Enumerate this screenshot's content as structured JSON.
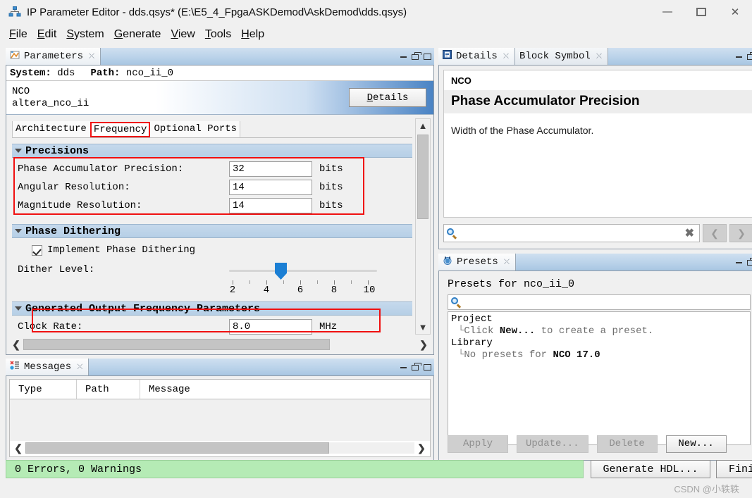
{
  "window": {
    "title": "IP Parameter Editor - dds.qsys* (E:\\E5_4_FpgaASKDemod\\AskDemod\\dds.qsys)",
    "icon": "ip-editor-icon",
    "controls": {
      "minimize": "—",
      "maximize": "□",
      "close": "✕"
    }
  },
  "menubar": {
    "items": [
      {
        "pre": "",
        "key": "F",
        "post": "ile"
      },
      {
        "pre": "",
        "key": "E",
        "post": "dit"
      },
      {
        "pre": "",
        "key": "S",
        "post": "ystem"
      },
      {
        "pre": "",
        "key": "G",
        "post": "enerate"
      },
      {
        "pre": "",
        "key": "V",
        "post": "iew"
      },
      {
        "pre": "",
        "key": "T",
        "post": "ools"
      },
      {
        "pre": "",
        "key": "H",
        "post": "elp"
      }
    ]
  },
  "parameters_panel": {
    "tab_label": "Parameters",
    "tab_icon": "parameters-icon",
    "system_label": "System:",
    "system_value": "dds",
    "path_label": "Path:",
    "path_value": "nco_ii_0",
    "component_name": "NCO",
    "component_id": "altera_nco_ii",
    "details_button": {
      "key": "D",
      "rest": "etails"
    },
    "tabs": [
      {
        "label": "Architecture",
        "selected": false
      },
      {
        "label": "Frequency",
        "selected": true
      },
      {
        "label": "Optional Ports",
        "selected": false
      }
    ],
    "groups": [
      {
        "title": "Precisions",
        "rows": [
          {
            "label": "Phase Accumulator Precision:",
            "value": "32",
            "unit": "bits"
          },
          {
            "label": "Angular Resolution:",
            "value": "14",
            "unit": "bits"
          },
          {
            "label": "Magnitude Resolution:",
            "value": "14",
            "unit": "bits"
          }
        ]
      },
      {
        "title": "Phase Dithering",
        "checkbox_label": "Implement Phase Dithering",
        "checkbox_checked": true,
        "slider_label": "Dither Level:",
        "slider_value": 4,
        "slider_ticks": [
          "2",
          "4",
          "6",
          "8",
          "10"
        ]
      },
      {
        "title": "Generated Output Frequency Parameters",
        "rows": [
          {
            "label": "Clock Rate:",
            "value": "8.0",
            "unit": "MHz"
          }
        ]
      }
    ]
  },
  "messages_panel": {
    "tab_label": "Messages",
    "tab_icon": "messages-icon",
    "columns": [
      "Type",
      "Path",
      "Message"
    ],
    "rows": []
  },
  "details_panel": {
    "tabs": [
      {
        "label": "Details",
        "icon": "details-icon",
        "selected": true
      },
      {
        "label": "Block Symbol",
        "icon": "block-symbol-icon",
        "selected": false
      }
    ],
    "doc_component": "NCO",
    "doc_title": "Phase Accumulator Precision",
    "doc_body": "Width of the Phase Accumulator.",
    "search_value": "",
    "search_placeholder": "",
    "clear_icon": "clear-icon",
    "prev_icon": "chevron-left-icon"
  },
  "presets_panel": {
    "tab_label": "Presets",
    "tab_icon": "presets-icon",
    "heading": "Presets for nco_ii_0",
    "search_value": "",
    "tree": [
      {
        "level": 0,
        "text": "Project",
        "muted": false
      },
      {
        "level": 1,
        "prefix": "Click ",
        "bold": "New...",
        "suffix": " to create a preset.",
        "muted": true
      },
      {
        "level": 0,
        "text": "Library",
        "muted": false
      },
      {
        "level": 1,
        "prefix": "No presets for ",
        "bold": "NCO 17.0",
        "suffix": "",
        "muted": true
      }
    ],
    "buttons": [
      {
        "label": "Apply",
        "enabled": false
      },
      {
        "label": "Update...",
        "enabled": false
      },
      {
        "label": "Delete",
        "enabled": false
      },
      {
        "label": "New...",
        "enabled": true
      }
    ]
  },
  "statusbar": {
    "message": "0 Errors, 0 Warnings",
    "message_color": "#b5ebb5",
    "generate_hdl": "Generate HDL...",
    "finish": "Finish"
  },
  "watermark": "CSDN @小轶轶"
}
